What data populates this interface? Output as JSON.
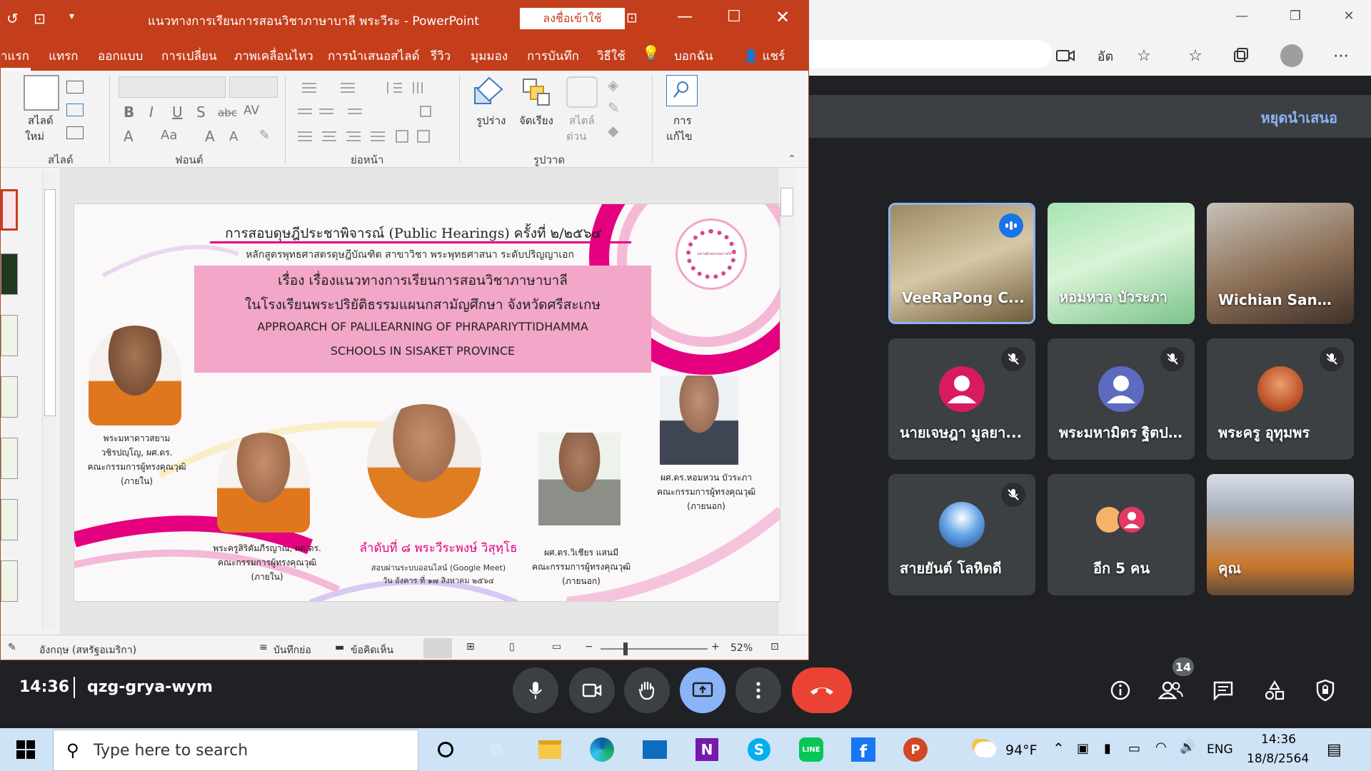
{
  "browser": {
    "window_buttons": [
      "—",
      "❐",
      "✕"
    ],
    "icons": [
      "camera-icon",
      "read-aloud-icon",
      "favorite-add-icon",
      "favorites-icon",
      "collections-icon",
      "profile-avatar",
      "more-icon"
    ],
    "read_aloud_label": "อัต"
  },
  "meet": {
    "stop_presenting": "หยุดนำเสนอ",
    "participants": [
      {
        "name": "VeeRaPong C...",
        "speaking": true,
        "muted": false
      },
      {
        "name": "หอมหวล บัวระภา",
        "speaking": false,
        "muted": false
      },
      {
        "name": "Wichian Sanm...",
        "speaking": false,
        "muted": false
      },
      {
        "name": "นายเจษฎา มูลยา...",
        "muted": true,
        "avatar_color": "#d81b60"
      },
      {
        "name": "พระมหามิตร ฐิตป...",
        "muted": true,
        "avatar_color": "#5c6bc0"
      },
      {
        "name": "พระครู อุทุมพร",
        "muted": true
      },
      {
        "name": "สายยันต์ โลหิตดี",
        "muted": true
      },
      {
        "name": "อีก 5 คน",
        "muted": false
      },
      {
        "name": "คุณ",
        "muted": false
      }
    ],
    "time": "14:36",
    "meeting_code": "qzg-grya-wym",
    "people_count": "14"
  },
  "ppt": {
    "title": "แนวทางการเรียนการสอนวิชาภาษาบาลี พระวีระ  -  PowerPoint",
    "signin": "ลงชื่อเข้าใช้",
    "tabs": [
      "าแรก",
      "แทรก",
      "ออกแบบ",
      "การเปลี่ยน",
      "ภาพเคลื่อนไหว",
      "การนำเสนอสไลด์",
      "รีวิว",
      "มุมมอง",
      "การบันทึก",
      "วิธีใช้",
      "บอกฉัน",
      "แชร์"
    ],
    "ribbon": {
      "new_slide_1": "สไลด์",
      "new_slide_2": "ใหม่",
      "group_slides": "สไลด์",
      "group_font": "ฟอนต์",
      "group_paragraph": "ย่อหน้า",
      "group_drawing": "รูปวาด",
      "shapes": "รูปร่าง",
      "arrange": "จัดเรียง",
      "quick_styles_1": "สไตล์",
      "quick_styles_2": "ด่วน",
      "editing_1": "การ",
      "editing_2": "แก้ไข"
    },
    "status": {
      "language": "อังกฤษ (สหรัฐอเมริกา)",
      "notes": "บันทึกย่อ",
      "comments": "ข้อคิดเห็น",
      "zoom": "52%"
    }
  },
  "slide": {
    "title": "การสอบดุษฎีประชาพิจารณ์ (Public Hearings) ครั้งที่ ๒/๒๕๖๔",
    "subtitle": "หลักสูตรพุทธศาสตรดุษฎีบัณฑิต สาขาวิชา พระพุทธศาสนา ระดับปริญญาเอก",
    "topic_1": "เรื่อง เรื่องแนวทางการเรียนการสอนวิชาภาษาบาลี",
    "topic_2": "ในโรงเรียนพระปริยัติธรรมแผนกสามัญศึกษา จังหวัดศรีสะเกษ",
    "topic_3": "APPROARCH OF PALILEARNING OF PHRAPARIYTTIDHAMMA",
    "topic_4": "SCHOOLS IN SISAKET PROVINCE",
    "seal_text": "มหาจุฬาลงกรณราชวิทยาลัย",
    "people": [
      {
        "l1": "พระมหาดาวสยาม",
        "l2": "วชิรปญฺโญ, ผศ.ดร.",
        "l3": "คณะกรรมการผู้ทรงคุณวุฒิ",
        "l4": "(ภายใน)"
      },
      {
        "l1": "พระครูสิริคัมภีรญาณ, ผศ.ดร.",
        "l2": "คณะกรรมการผู้ทรงคุณวุฒิ",
        "l3": "(ภายใน)"
      },
      {
        "l1": "ผศ.ดร.วิเชียร แสนมี",
        "l2": "คณะกรรมการผู้ทรงคุณวุฒิ",
        "l3": "(ภายนอก)"
      },
      {
        "l1": "ผศ.ดร.หอมหวน บัวระภา",
        "l2": "คณะกรรมการผู้ทรงคุณวุฒิ",
        "l3": "(ภายนอก)"
      }
    ],
    "presenter": "ลำดับที่ ๘ พระวีระพงษ์ วิสุทฺโธ",
    "presenter_sub1": "สอบผ่านระบบออนไลน์ (Google Meet)",
    "presenter_sub2": "วัน อังคาร ที่ ๑๗ สิงหาคม ๒๕๖๔"
  },
  "taskbar": {
    "search_placeholder": "Type here to search",
    "weather": "94°F",
    "lang": "ENG",
    "time": "14:36",
    "date": "18/8/2564"
  },
  "colors": {
    "ppt_red": "#c43e1c",
    "meet_bg": "#202124",
    "meet_tile": "#3c4043",
    "end_call": "#ea4335",
    "present_blue": "#8ab4f8",
    "slide_pink": "#f2a6c8",
    "slide_magenta": "#e4007f"
  }
}
